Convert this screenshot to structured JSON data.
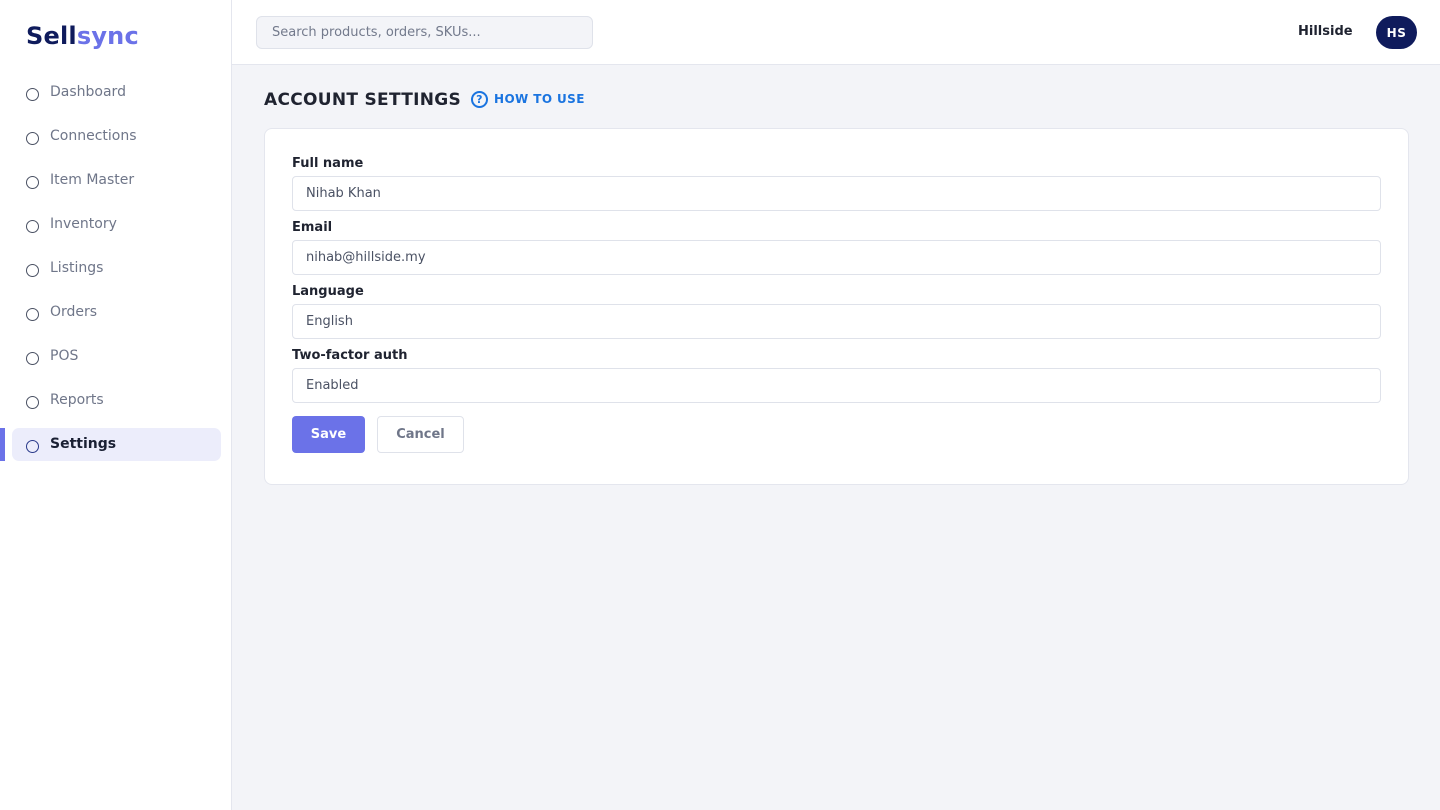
{
  "brand": {
    "part1": "Sell",
    "part2": "sync"
  },
  "search": {
    "placeholder": "Search products, orders, SKUs..."
  },
  "header": {
    "org_name": "Hillside",
    "avatar_initials": "HS"
  },
  "sidebar": {
    "items": [
      {
        "label": "Dashboard",
        "active": false
      },
      {
        "label": "Connections",
        "active": false
      },
      {
        "label": "Item Master",
        "active": false
      },
      {
        "label": "Inventory",
        "active": false
      },
      {
        "label": "Listings",
        "active": false
      },
      {
        "label": "Orders",
        "active": false
      },
      {
        "label": "POS",
        "active": false
      },
      {
        "label": "Reports",
        "active": false
      },
      {
        "label": "Settings",
        "active": true
      }
    ]
  },
  "page": {
    "title": "ACCOUNT SETTINGS",
    "how_to_use": "HOW TO USE",
    "help_icon": "?"
  },
  "form": {
    "fields": [
      {
        "label": "Full name",
        "value": "Nihab Khan"
      },
      {
        "label": "Email",
        "value": "nihab@hillside.my"
      },
      {
        "label": "Language",
        "value": "English"
      },
      {
        "label": "Two-factor auth",
        "value": "Enabled"
      }
    ],
    "save_label": "Save",
    "cancel_label": "Cancel"
  },
  "colors": {
    "accent": "#6b72e8",
    "brand_dark": "#0f1b5c",
    "link": "#1a74e0"
  }
}
